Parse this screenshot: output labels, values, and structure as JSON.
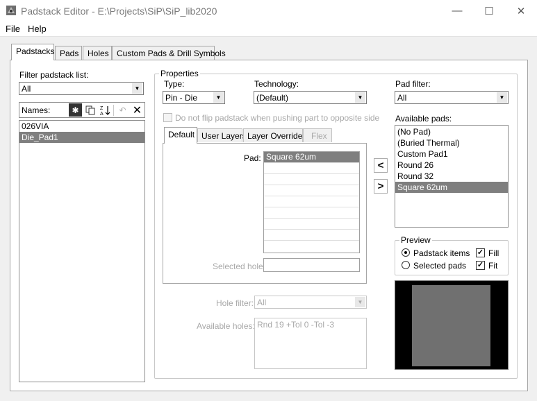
{
  "window": {
    "title": "Padstack Editor - E:\\Projects\\SiP\\SiP_lib2020",
    "minimize": "—",
    "maximize": "☐",
    "close": "✕"
  },
  "menu": {
    "items": [
      "File",
      "Help"
    ]
  },
  "tabs": [
    "Padstacks",
    "Pads",
    "Holes",
    "Custom Pads & Drill Symbols"
  ],
  "left": {
    "filter_label": "Filter padstack list:",
    "filter_value": "All",
    "names_label": "Names:",
    "padstacks": [
      "026VIA",
      "Die_Pad1"
    ],
    "selected_padstack": "Die_Pad1"
  },
  "properties": {
    "group_title": "Properties",
    "type_label": "Type:",
    "type_value": "Pin - Die",
    "technology_label": "Technology:",
    "technology_value": "(Default)",
    "no_flip_label": "Do not flip padstack when pushing part to opposite side",
    "subtabs": [
      "Default",
      "User Layers",
      "Layer Overrides",
      "Flex"
    ],
    "pad_label": "Pad:",
    "pad_value": "Square 62um",
    "selected_hole_label": "Selected hole:",
    "hole_filter_label": "Hole filter:",
    "hole_filter_value": "All",
    "available_holes_label": "Available holes:",
    "available_holes": [
      "Rnd 19 +Tol 0 -Tol -3"
    ]
  },
  "pad_filter": {
    "label": "Pad filter:",
    "value": "All",
    "available_label": "Available pads:",
    "pads": [
      "(No Pad)",
      "(Buried Thermal)",
      "Custom Pad1",
      "Round 26",
      "Round 32",
      "Square 62um"
    ],
    "selected": "Square 62um"
  },
  "preview": {
    "title": "Preview",
    "padstack_items_label": "Padstack items",
    "selected_pads_label": "Selected pads",
    "fill_label": "Fill",
    "fit_label": "Fit",
    "fill_checked": true,
    "fit_checked": true,
    "mode": "Padstack items",
    "background_color": "#000000",
    "pad_color": "#707070"
  }
}
